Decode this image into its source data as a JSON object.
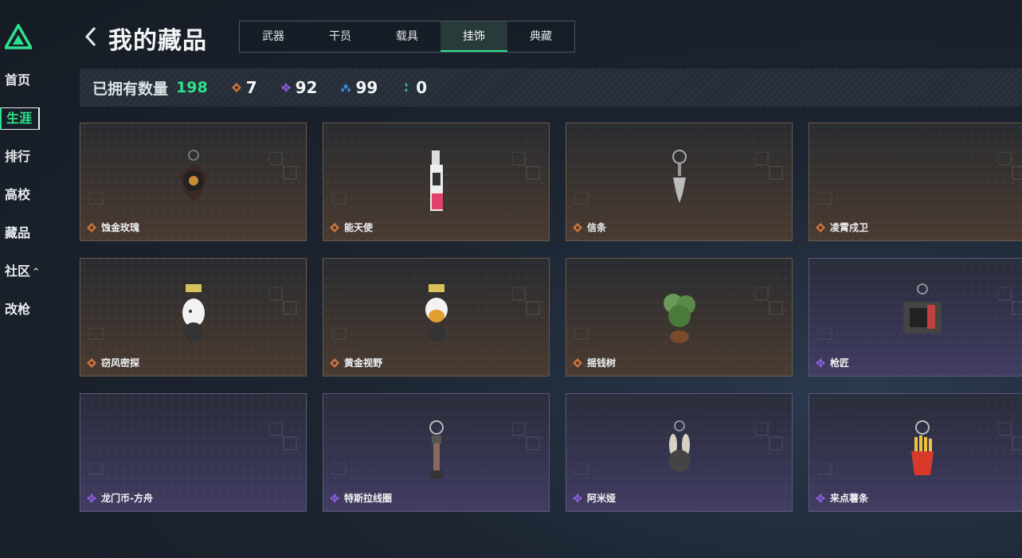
{
  "sidebar": {
    "items": [
      {
        "label": "首页"
      },
      {
        "label": "生涯"
      },
      {
        "label": "排行"
      },
      {
        "label": "高校"
      },
      {
        "label": "藏品"
      },
      {
        "label": "社区"
      },
      {
        "label": "改枪"
      }
    ],
    "active_index": 1
  },
  "header": {
    "title": "我的藏品",
    "tabs": [
      {
        "label": "武器"
      },
      {
        "label": "干员"
      },
      {
        "label": "载具"
      },
      {
        "label": "挂饰"
      },
      {
        "label": "典藏"
      }
    ],
    "active_tab": 3
  },
  "stats": {
    "owned_label": "已拥有数量",
    "owned_count": "198",
    "tiers": [
      {
        "icon": "gold-gem-icon",
        "color": "#d0733a",
        "count": "7"
      },
      {
        "icon": "purple-gem-icon",
        "color": "#8a5cd8",
        "count": "92"
      },
      {
        "icon": "blue-gem-icon",
        "color": "#3a8ad8",
        "count": "99"
      },
      {
        "icon": "green-gem-icon",
        "color": "#2fb890",
        "count": "0"
      }
    ]
  },
  "items": [
    {
      "name": "蚀金玫瑰",
      "rarity": "gold"
    },
    {
      "name": "能天使",
      "rarity": "gold"
    },
    {
      "name": "信条",
      "rarity": "gold"
    },
    {
      "name": "凌霄戍卫",
      "rarity": "gold"
    },
    {
      "name": "窃风密探",
      "rarity": "gold"
    },
    {
      "name": "黄金视野",
      "rarity": "gold"
    },
    {
      "name": "摇钱树",
      "rarity": "gold"
    },
    {
      "name": "枪匠",
      "rarity": "purple"
    },
    {
      "name": "龙门币-方舟",
      "rarity": "purple"
    },
    {
      "name": "特斯拉线圈",
      "rarity": "purple"
    },
    {
      "name": "阿米娅",
      "rarity": "purple"
    },
    {
      "name": "来点薯条",
      "rarity": "purple"
    }
  ],
  "colors": {
    "accent": "#2fe08d",
    "gold": "#d0733a",
    "purple": "#8a5cd8"
  }
}
